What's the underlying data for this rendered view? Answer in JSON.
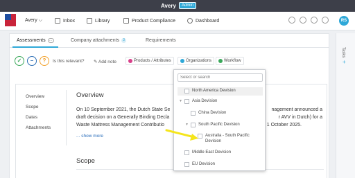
{
  "window": {
    "title": "Avery",
    "badge": "Admin"
  },
  "nav": {
    "user": "Avery ⌵",
    "items": [
      {
        "label": "Inbox",
        "icon": "inbox-icon"
      },
      {
        "label": "Library",
        "icon": "library-icon"
      },
      {
        "label": "Product Compliance",
        "icon": "compliance-icon"
      },
      {
        "label": "Dashboard",
        "icon": "dashboard-icon"
      }
    ],
    "avatar": "RS"
  },
  "tabs": [
    {
      "label": "Assessments",
      "count": "···",
      "active": true
    },
    {
      "label": "Company attachments",
      "count": "3",
      "active": false
    },
    {
      "label": "Requirements",
      "count": "",
      "active": false
    }
  ],
  "actions": {
    "question": "Is this relevant?",
    "add_note": "Add note",
    "products": "Products / Attributes",
    "organizations": "Organizations",
    "workflow": "Workflow"
  },
  "toc": [
    "Overview",
    "Scope",
    "Dates",
    "Attachments"
  ],
  "overview": {
    "heading": "Overview",
    "paragraph_line1": "On 10 September 2021, the Dutch State Se",
    "paragraph_line1_end": "nagement announced a",
    "paragraph_line2": "draft decision on a Generally Binding Decla",
    "paragraph_line2_end": "r AVV in Dutch) for a",
    "paragraph_line3": "Waste Mattress Management Contributio",
    "paragraph_line3_end": "1 October 2025.",
    "show_more": "... show more"
  },
  "scope": {
    "heading": "Scope"
  },
  "rail": {
    "label": "Tasks",
    "plus": "+"
  },
  "dropdown": {
    "placeholder": "Select or search",
    "items": [
      {
        "label": "North America Devision",
        "level": 0,
        "expandable": false
      },
      {
        "label": "Asia Devision",
        "level": 0,
        "expandable": true
      },
      {
        "label": "China Devision",
        "level": 1,
        "expandable": false
      },
      {
        "label": "South Pacific Devision",
        "level": 1,
        "expandable": true
      },
      {
        "label": "Australia - South Pacific Devision",
        "level": 2,
        "expandable": false
      },
      {
        "label": "Middle East Devision",
        "level": 0,
        "expandable": false
      },
      {
        "label": "EU Devision",
        "level": 0,
        "expandable": false
      }
    ]
  },
  "colors": {
    "accent": "#2ea8d8",
    "yes": "#3aa85a",
    "no": "#2d6fb5",
    "unsure": "#f2a12b",
    "arrow": "#f5e51b"
  }
}
